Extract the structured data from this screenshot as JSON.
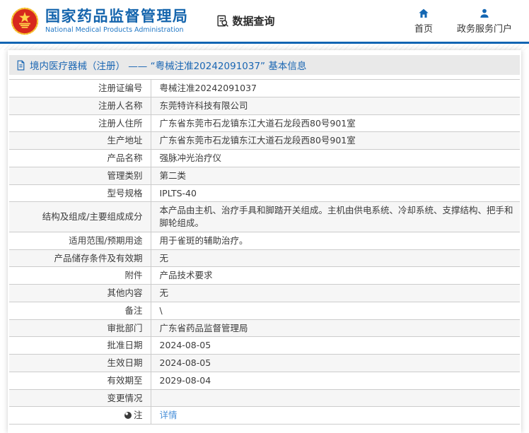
{
  "header": {
    "org_name_cn": "国家药品监督管理局",
    "org_name_en": "National Medical Products Administration",
    "data_query_label": "数据查询",
    "nav": [
      {
        "label": "首页",
        "icon": "home-icon"
      },
      {
        "label": "政务服务门户",
        "icon": "user-icon"
      }
    ]
  },
  "page": {
    "title": "境内医疗器械（注册） —— “粤械注准20242091037” 基本信息"
  },
  "table": {
    "rows": [
      {
        "label": "注册证编号",
        "value": "粤械注准20242091037"
      },
      {
        "label": "注册人名称",
        "value": "东莞特许科技有限公司"
      },
      {
        "label": "注册人住所",
        "value": "广东省东莞市石龙镇东江大道石龙段西80号901室"
      },
      {
        "label": "生产地址",
        "value": "广东省东莞市石龙镇东江大道石龙段西80号901室"
      },
      {
        "label": "产品名称",
        "value": "强脉冲光治疗仪"
      },
      {
        "label": "管理类别",
        "value": "第二类"
      },
      {
        "label": "型号规格",
        "value": "IPLTS-40"
      },
      {
        "label": "结构及组成/主要组成成分",
        "value": "本产品由主机、治疗手具和脚踏开关组成。主机由供电系统、冷却系统、支撑结构、把手和脚轮组成。"
      },
      {
        "label": "适用范围/预期用途",
        "value": "用于雀斑的辅助治疗。"
      },
      {
        "label": "产品储存条件及有效期",
        "value": "无"
      },
      {
        "label": "附件",
        "value": "产品技术要求"
      },
      {
        "label": "其他内容",
        "value": "无"
      },
      {
        "label": "备注",
        "value": "\\"
      },
      {
        "label": "审批部门",
        "value": "广东省药品监督管理局"
      },
      {
        "label": "批准日期",
        "value": "2024-08-05"
      },
      {
        "label": "生效日期",
        "value": "2024-08-05"
      },
      {
        "label": "有效期至",
        "value": "2029-08-04"
      },
      {
        "label": "变更情况",
        "value": ""
      },
      {
        "label": "注",
        "value": "详情",
        "value_is_link": true,
        "label_icon": "note-dot-icon"
      }
    ]
  },
  "colors": {
    "accent_blue": "#1265b3",
    "title_blue": "#1a66b3",
    "link_blue": "#4a90d9",
    "emblem_red": "#d7281d",
    "emblem_gold": "#f0b428",
    "title_bar_bg": "#e9e9e9",
    "row_alt_bg": "#f6f6f6",
    "border_gray": "#cccccc"
  }
}
